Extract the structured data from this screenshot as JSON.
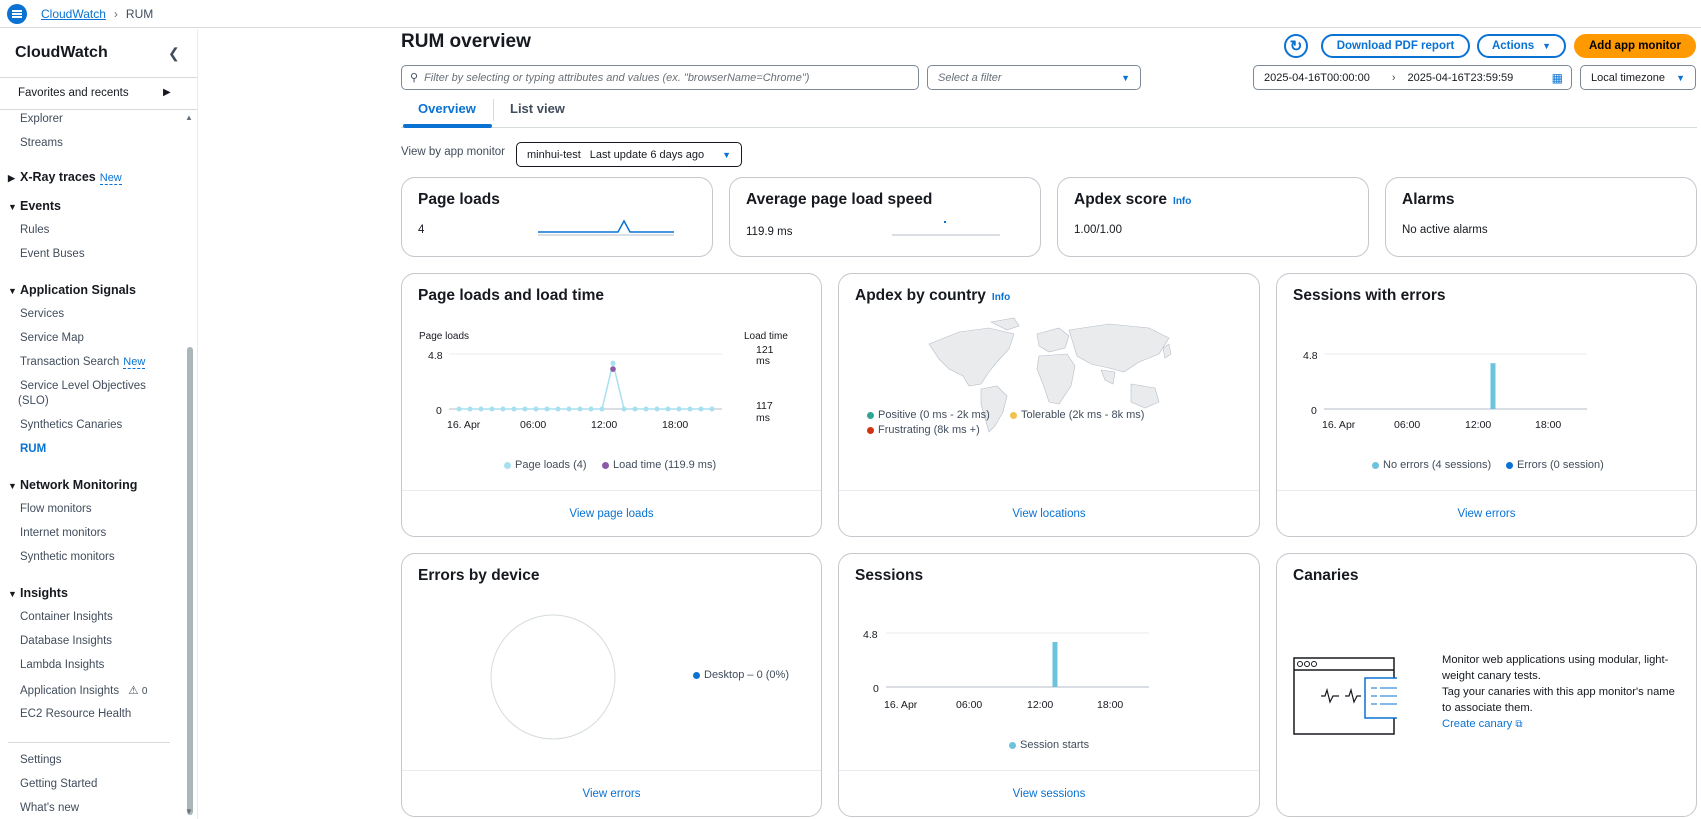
{
  "breadcrumb": {
    "root": "CloudWatch",
    "current": "RUM"
  },
  "sidebar": {
    "title": "CloudWatch",
    "favorites": "Favorites and recents",
    "items_top": [
      "Explorer",
      "Streams"
    ],
    "xray": {
      "label": "X-Ray traces",
      "badge": "New"
    },
    "events": {
      "label": "Events",
      "items": [
        "Rules",
        "Event Buses"
      ]
    },
    "app_signals": {
      "label": "Application Signals",
      "items": [
        "Services",
        "Service Map",
        "Transaction Search",
        "Service Level Objectives",
        "(SLO)",
        "Synthetics Canaries",
        "RUM"
      ],
      "badge": "New"
    },
    "network": {
      "label": "Network Monitoring",
      "items": [
        "Flow monitors",
        "Internet monitors",
        "Synthetic monitors"
      ]
    },
    "insights": {
      "label": "Insights",
      "items": [
        "Container Insights",
        "Database Insights",
        "Lambda Insights",
        "Application Insights",
        "EC2 Resource Health"
      ],
      "app_insights_count": "0"
    },
    "bottom": [
      "Settings",
      "Getting Started",
      "What's new"
    ]
  },
  "header": {
    "title": "RUM overview",
    "download": "Download PDF report",
    "actions": "Actions",
    "add": "Add app monitor"
  },
  "filter": {
    "search_placeholder": "Filter by selecting or typing attributes and values (ex. \"browserName=Chrome\")",
    "select_placeholder": "Select a filter",
    "start": "2025-04-16T00:00:00",
    "end": "2025-04-16T23:59:59",
    "timezone": "Local timezone"
  },
  "tabs": [
    "Overview",
    "List view"
  ],
  "view_by": {
    "label": "View by app monitor",
    "monitor": "minhui-test",
    "update": "Last update 6 days ago"
  },
  "summary": {
    "page_loads": {
      "title": "Page loads",
      "value": "4"
    },
    "speed": {
      "title": "Average page load speed",
      "value": "119.9 ms"
    },
    "apdex": {
      "title": "Apdex score",
      "info": "Info",
      "value": "1.00/1.00"
    },
    "alarms": {
      "title": "Alarms",
      "value": "No active alarms"
    }
  },
  "cards": {
    "loads_time": {
      "title": "Page loads and load time",
      "left_axis": "Page loads",
      "right_axis": "Load time",
      "y_top": "4.8",
      "y_zero": "0",
      "r_top": "121",
      "r_bot": "117",
      "unit": "ms",
      "legend1": "Page loads (4)",
      "legend2": "Load time (119.9 ms)",
      "footer": "View page loads"
    },
    "apdex_country": {
      "title": "Apdex by country",
      "info": "Info",
      "positive": "Positive (0 ms - 2k ms)",
      "tolerable": "Tolerable (2k ms - 8k ms)",
      "frustrating": "Frustrating (8k ms +)",
      "footer": "View locations"
    },
    "sessions_errors": {
      "title": "Sessions with errors",
      "y_top": "4.8",
      "y_zero": "0",
      "legend1": "No errors (4 sessions)",
      "legend2": "Errors (0 session)",
      "footer": "View errors"
    },
    "errors_device": {
      "title": "Errors by device",
      "legend": "Desktop – 0 (0%)",
      "footer": "View errors"
    },
    "sessions": {
      "title": "Sessions",
      "y_top": "4.8",
      "y_zero": "0",
      "legend": "Session starts",
      "footer": "View sessions"
    },
    "canaries": {
      "title": "Canaries",
      "text1": "Monitor web applications using modular, light-weight canary tests.",
      "text2": "Tag your canaries with this app monitor's name to associate them.",
      "link": "Create canary"
    }
  },
  "x_ticks": [
    "16. Apr",
    "06:00",
    "12:00",
    "18:00"
  ],
  "chart_data": [
    {
      "type": "line",
      "title": "Page loads and load time",
      "x": [
        "00:00",
        "01:00",
        "02:00",
        "03:00",
        "04:00",
        "05:00",
        "06:00",
        "07:00",
        "08:00",
        "09:00",
        "10:00",
        "11:00",
        "12:00",
        "13:00",
        "14:00",
        "15:00",
        "16:00",
        "17:00",
        "18:00",
        "19:00",
        "20:00",
        "21:00",
        "22:00",
        "23:00"
      ],
      "series": [
        {
          "name": "Page loads (4)",
          "values": [
            0,
            0,
            0,
            0,
            0,
            0,
            0,
            0,
            0,
            0,
            0,
            0,
            0,
            0,
            4,
            0,
            0,
            0,
            0,
            0,
            0,
            0,
            0,
            0
          ]
        },
        {
          "name": "Load time (119.9 ms)",
          "values": [
            null,
            null,
            null,
            null,
            null,
            null,
            null,
            null,
            null,
            null,
            null,
            null,
            null,
            null,
            119.9,
            null,
            null,
            null,
            null,
            null,
            null,
            null,
            null,
            null
          ]
        }
      ],
      "ylim": [
        0,
        4.8
      ],
      "y2lim": [
        117,
        121
      ]
    },
    {
      "type": "bar",
      "title": "Sessions with errors",
      "series": [
        {
          "name": "No errors (4 sessions)",
          "x": "15:00",
          "value": 4
        },
        {
          "name": "Errors (0 session)",
          "value": 0
        }
      ],
      "ylim": [
        0,
        4.8
      ]
    },
    {
      "type": "pie",
      "title": "Errors by device",
      "values": [
        {
          "label": "Desktop",
          "value": 0
        }
      ]
    },
    {
      "type": "bar",
      "title": "Sessions",
      "series": [
        {
          "name": "Session starts",
          "x": "15:00",
          "value": 4
        }
      ],
      "ylim": [
        0,
        4.8
      ]
    }
  ],
  "colors": {
    "accent": "#0972d3",
    "primary_btn": "#ff9900",
    "positive": "#2ea597",
    "tolerable": "#f2c14e",
    "frustrating": "#d13212",
    "page_loads": "#a8e0f0",
    "load_time": "#8b5aa8",
    "no_errors": "#6cc3dd",
    "errors": "#0972d3"
  }
}
